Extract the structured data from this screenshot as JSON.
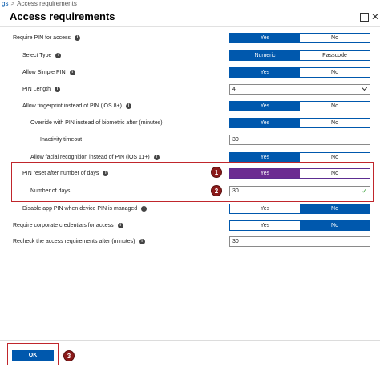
{
  "breadcrumb": {
    "link": "gs",
    "separator": ">",
    "current": "Access requirements"
  },
  "header": {
    "title": "Access requirements"
  },
  "icons": {
    "maximize": "maximize-icon",
    "close": "close-icon",
    "info": "info-icon",
    "check": "check-icon",
    "chevron": "chevron-down-icon"
  },
  "settings": {
    "require_pin": {
      "label": "Require PIN for access",
      "options": [
        "Yes",
        "No"
      ],
      "selected": "Yes"
    },
    "select_type": {
      "label": "Select Type",
      "options": [
        "Numeric",
        "Passcode"
      ],
      "selected": "Numeric"
    },
    "allow_simple_pin": {
      "label": "Allow Simple PIN",
      "options": [
        "Yes",
        "No"
      ],
      "selected": "Yes"
    },
    "pin_length": {
      "label": "PIN Length",
      "value": "4"
    },
    "allow_fingerprint": {
      "label": "Allow fingerprint instead of PIN (iOS 8+)",
      "options": [
        "Yes",
        "No"
      ],
      "selected": "Yes"
    },
    "override_biometric": {
      "label": "Override with PIN instead of biometric after (minutes)",
      "options": [
        "Yes",
        "No"
      ],
      "selected": "Yes"
    },
    "inactivity_timeout": {
      "label": "Inactivity timeout",
      "value": "30"
    },
    "allow_facial": {
      "label": "Allow facial recognition instead of PIN (iOS 11+)",
      "options": [
        "Yes",
        "No"
      ],
      "selected": "Yes"
    },
    "pin_reset": {
      "label": "PIN reset after number of days",
      "options": [
        "Yes",
        "No"
      ],
      "selected": "Yes"
    },
    "number_of_days": {
      "label": "Number of days",
      "value": "30"
    },
    "disable_app_pin": {
      "label": "Disable app PIN when device PIN is managed",
      "options": [
        "Yes",
        "No"
      ],
      "selected": "No"
    },
    "corporate_credentials": {
      "label": "Require corporate credentials for access",
      "options": [
        "Yes",
        "No"
      ],
      "selected": "No"
    },
    "recheck": {
      "label": "Recheck the access requirements after (minutes)",
      "value": "30"
    }
  },
  "annotations": {
    "badge1": "1",
    "badge2": "2",
    "badge3": "3"
  },
  "footer": {
    "ok_label": "OK"
  },
  "colors": {
    "accent": "#0058ad",
    "highlight": "#6b2c91",
    "annotation": "#c0262c",
    "badge": "#8b1a1a"
  }
}
